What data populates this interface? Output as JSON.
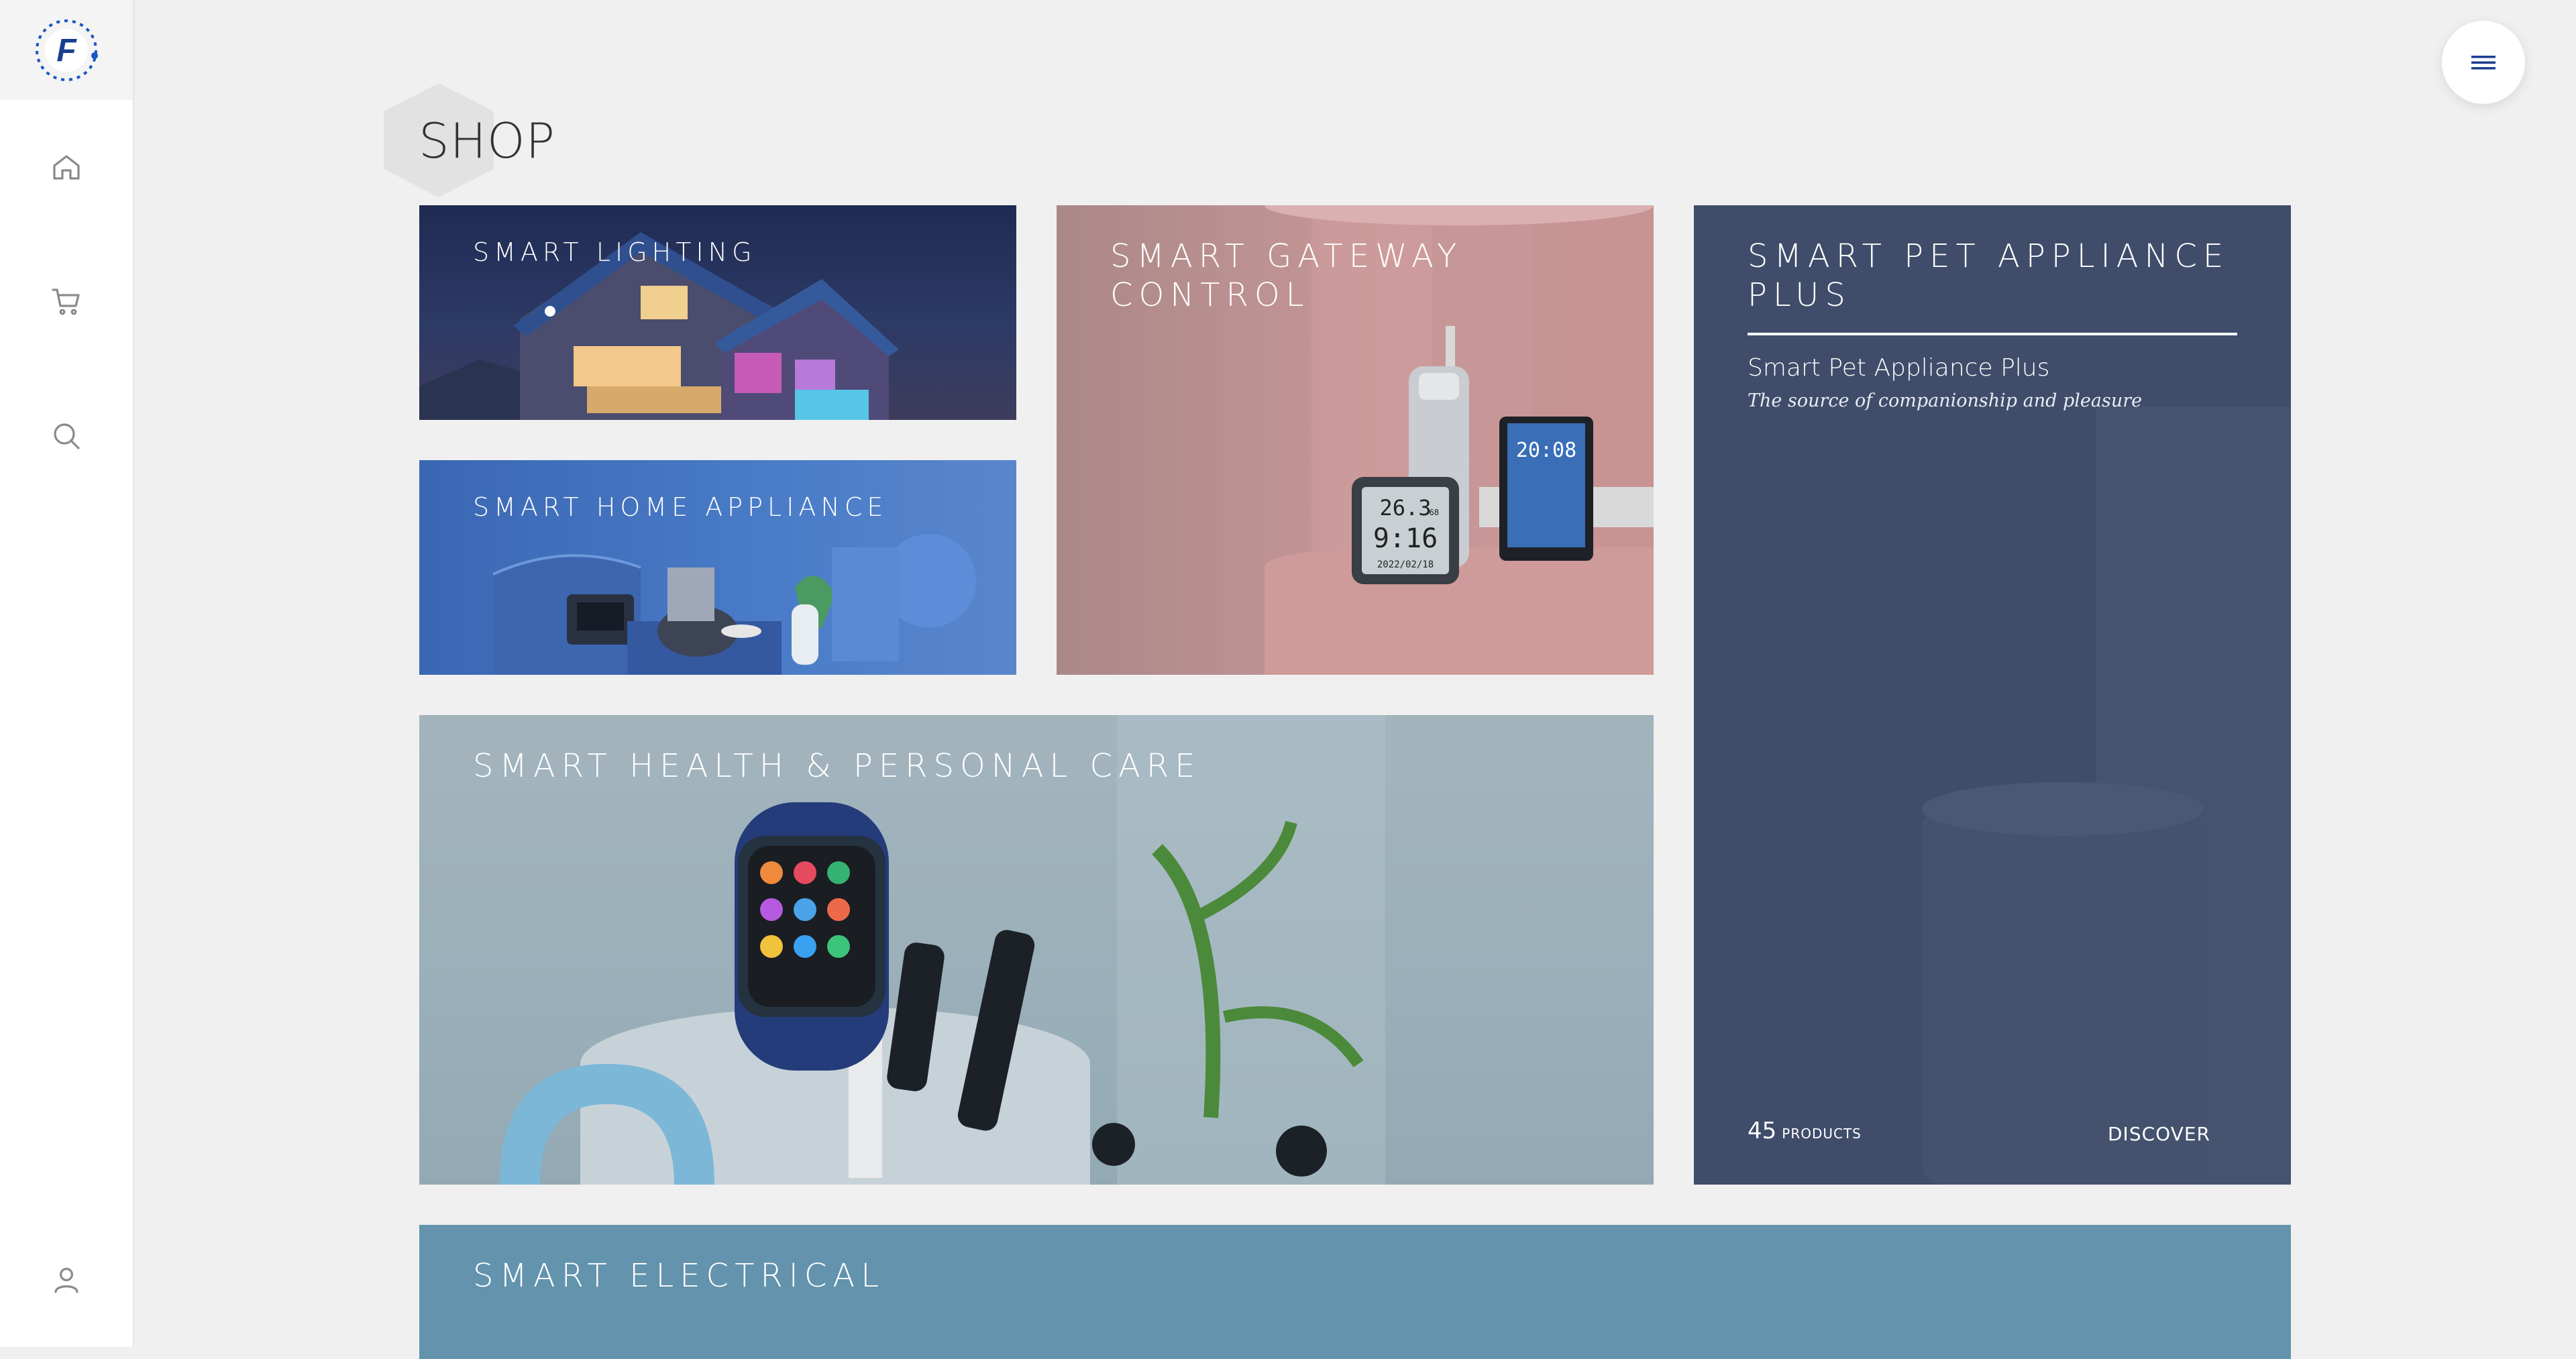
{
  "brand": {
    "logo_letter": "F",
    "accent": "#1a56c4"
  },
  "sidebar": {
    "items": [
      {
        "icon": "home-icon"
      },
      {
        "icon": "cart-icon"
      },
      {
        "icon": "search-icon"
      },
      {
        "icon": "user-icon"
      }
    ]
  },
  "header": {
    "menu_icon": "hamburger-icon"
  },
  "page": {
    "title": "SHOP"
  },
  "categories": {
    "lighting": {
      "label": "SMART LIGHTING"
    },
    "home_appliance": {
      "label": "SMART HOME APPLIANCE"
    },
    "gateway": {
      "label": "SMART GATEWAY CONTROL"
    },
    "health": {
      "label": "SMART HEALTH & PERSONAL CARE"
    },
    "pet": {
      "label": "SMART PET APPLIANCE PLUS",
      "subtitle": "Smart Pet Appliance Plus",
      "tagline": "The source of companionship and pleasure",
      "count": "45",
      "count_unit": "PRODUCTS",
      "cta": "DISCOVER"
    },
    "electrical": {
      "label": "SMART ELECTRICAL"
    }
  },
  "device_displays": {
    "sensor_top": "26.3",
    "sensor_small": "68",
    "sensor_time": "9:16",
    "sensor_date": "2022/02/18",
    "panel_time": "20:08"
  },
  "colors": {
    "background": "#f0f0f0",
    "pet_card": "#3f4d6a",
    "electrical_card": "#6393ad",
    "home_card": "#4a7cc8",
    "gateway_card": "#c79797",
    "health_card": "#9aafb9"
  }
}
